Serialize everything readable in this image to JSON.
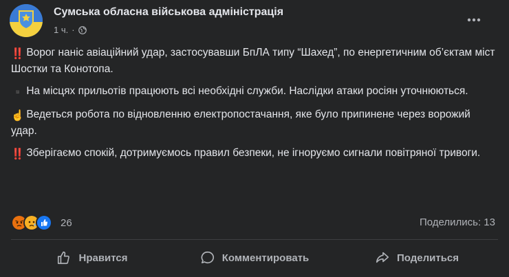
{
  "post": {
    "author": "Сумська обласна військова адміністрація",
    "time": "1 ч.",
    "separator": "·",
    "privacy_icon": "globe-icon",
    "paragraphs": [
      {
        "emoji": "‼️",
        "text": "Ворог наніс авіаційний удар, застосувавши БпЛА типу “Шахед”, по енергетичним об’єктам міст Шостки та Конотопа."
      },
      {
        "emoji": "▪️",
        "text": "На місцях прильотів працюють всі необхідні служби. Наслідки атаки росіян уточнюються."
      },
      {
        "emoji": "☝️",
        "text": "Ведеться  робота по відновленню електропостачання, яке було припинене через ворожий удар."
      },
      {
        "emoji": "‼️",
        "text": "Зберігаємо спокій, дотримуємось правил безпеки, не ігноруємо сигнали повітряної тривоги."
      }
    ]
  },
  "reactions": {
    "icons": [
      "angry-icon",
      "sad-icon",
      "like-icon"
    ],
    "count": "26",
    "shares": "Поделились: 13"
  },
  "actions": {
    "like": "Нравится",
    "comment": "Комментировать",
    "share": "Поделиться"
  },
  "colors": {
    "background": "#242526",
    "text": "#e4e6eb",
    "secondary": "#b0b3b8",
    "like_blue": "#1877f2",
    "angry": "#e9710f",
    "sad": "#f7b125"
  }
}
